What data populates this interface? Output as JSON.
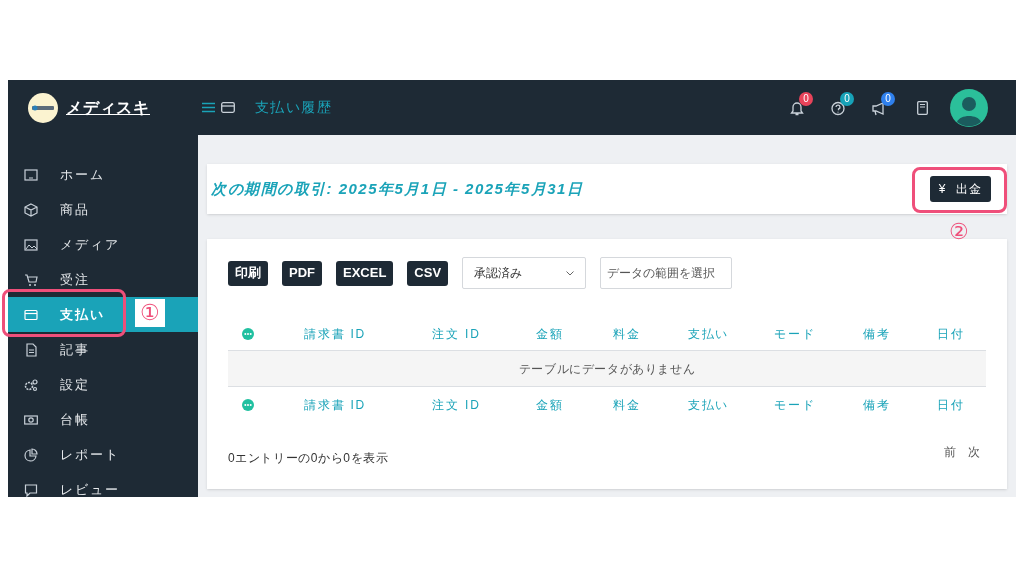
{
  "brand": {
    "name": "メディスキ"
  },
  "header": {
    "page_title": "支払い履歴",
    "notifications": [
      {
        "kind": "bell",
        "count": "0",
        "color": "#e8435a"
      },
      {
        "kind": "help",
        "count": "0",
        "color": "#17a2b8"
      },
      {
        "kind": "megaphone",
        "count": "0",
        "color": "#2f80ed"
      }
    ]
  },
  "sidebar": {
    "items": [
      {
        "kind": "home",
        "label": "ホーム",
        "selected": false
      },
      {
        "kind": "box",
        "label": "商品",
        "selected": false
      },
      {
        "kind": "image",
        "label": "メディア",
        "selected": false
      },
      {
        "kind": "cart",
        "label": "受注",
        "selected": false
      },
      {
        "kind": "card",
        "label": "支払い",
        "selected": true
      },
      {
        "kind": "doc",
        "label": "記事",
        "selected": false
      },
      {
        "kind": "gear",
        "label": "設定",
        "selected": false
      },
      {
        "kind": "money",
        "label": "台帳",
        "selected": false
      },
      {
        "kind": "pie",
        "label": "レポート",
        "selected": false
      },
      {
        "kind": "chat",
        "label": "レビュー",
        "selected": false
      }
    ]
  },
  "period": {
    "title": "次の期間の取引: 2025年5月1日 - 2025年5月31日",
    "button": {
      "icon": "¥",
      "label": "出金"
    }
  },
  "toolbar": {
    "buttons": [
      "印刷",
      "PDF",
      "EXCEL",
      "CSV"
    ],
    "status_select": {
      "value": "承認済み"
    },
    "date_range": {
      "placeholder": "データの範囲を選択"
    }
  },
  "table": {
    "columns": [
      "請求書 ID",
      "注文 ID",
      "金額",
      "料金",
      "支払い",
      "モード",
      "備考",
      "日付"
    ],
    "empty_message": "テーブルにデータがありません",
    "footer_columns": [
      "請求書 ID",
      "注文 ID",
      "金額",
      "料金",
      "支払い",
      "モード",
      "備考",
      "日付"
    ]
  },
  "table_info": "0エントリーの0から0を表示",
  "pagination": [
    "前",
    "次"
  ],
  "annotations": [
    "①",
    "②"
  ]
}
